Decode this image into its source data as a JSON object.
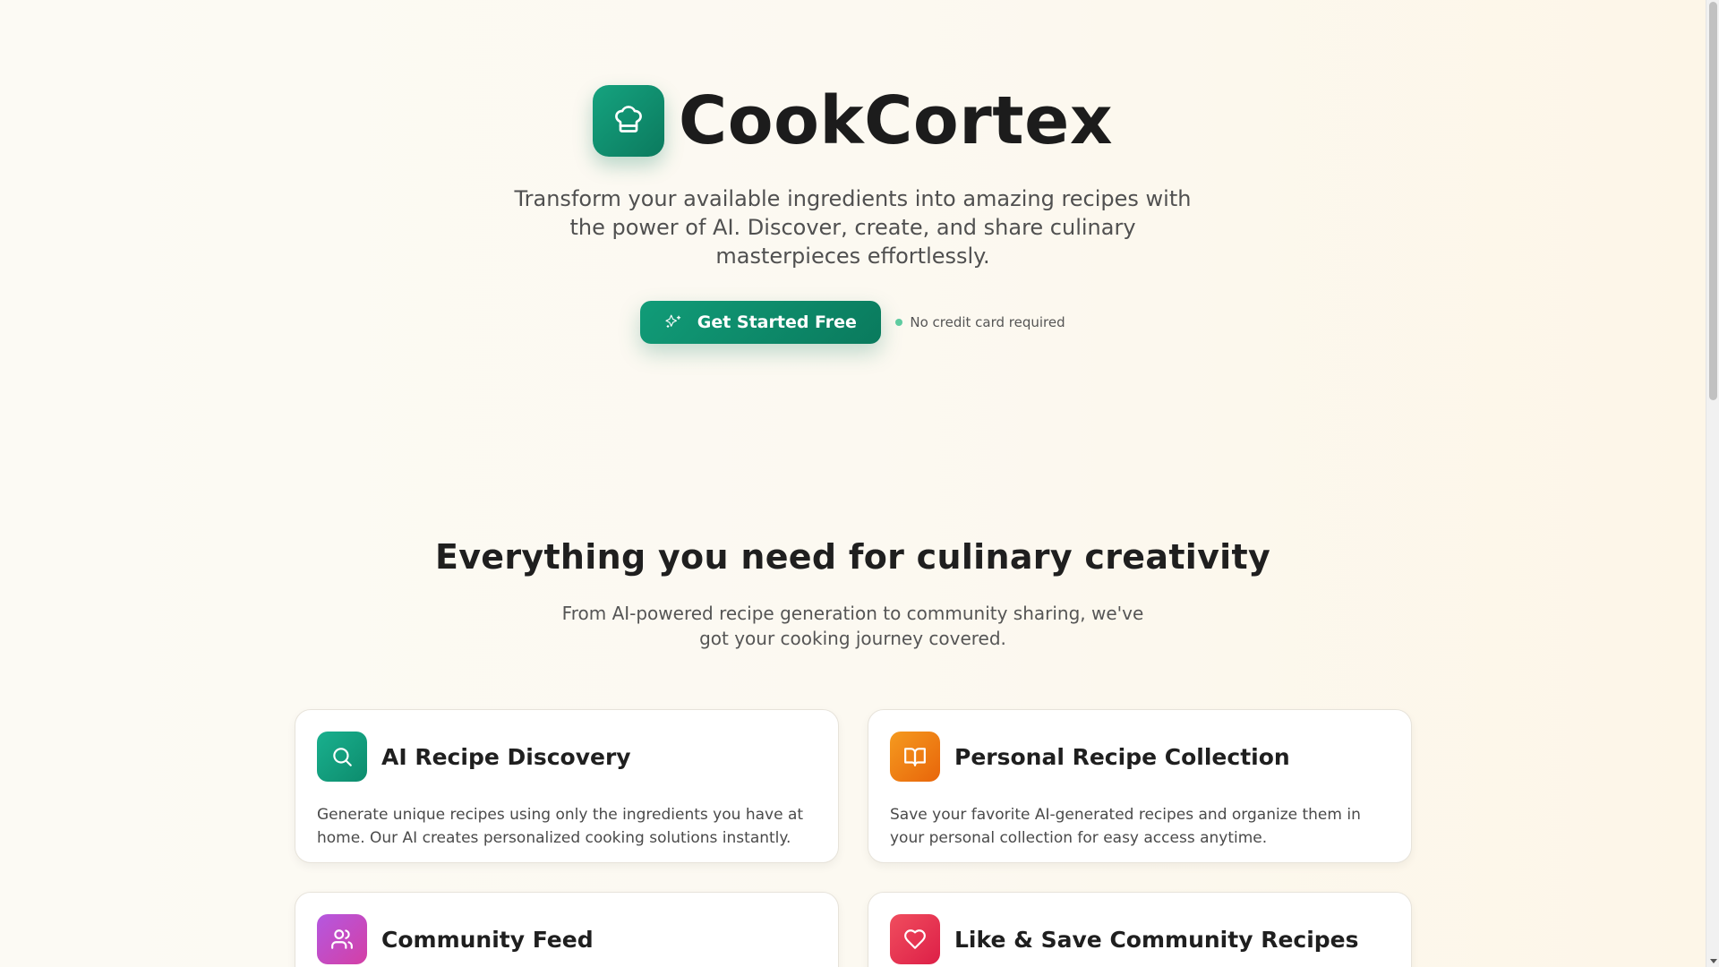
{
  "hero": {
    "brand": "CookCortex",
    "logo_icon": "chef-hat-icon",
    "subtitle": "Transform your available ingredients into amazing recipes with the power of AI. Discover, create, and share culinary masterpieces effortlessly.",
    "cta_label": "Get Started Free",
    "cta_icon": "sparkles-icon",
    "cta_note": "No credit card required"
  },
  "features": {
    "heading": "Everything you need for culinary creativity",
    "subheading": "From AI-powered recipe generation to community sharing, we've got your cooking journey covered.",
    "cards": [
      {
        "title": "AI Recipe Discovery",
        "description": "Generate unique recipes using only the ingredients you have at home. Our AI creates personalized cooking solutions instantly.",
        "icon": "search-icon",
        "color": "#0d8c6d"
      },
      {
        "title": "Personal Recipe Collection",
        "description": "Save your favorite AI-generated recipes and organize them in your personal collection for easy access anytime.",
        "icon": "book-open-icon",
        "color": "#e8650a"
      },
      {
        "title": "Community Feed",
        "description": "",
        "icon": "users-icon",
        "color": "#c14dc4"
      },
      {
        "title": "Like & Save Community Recipes",
        "description": "",
        "icon": "heart-icon",
        "color": "#dd1f47"
      }
    ]
  },
  "colors": {
    "brand_green": "#0b7a5e",
    "background": "#fcfaf4"
  }
}
